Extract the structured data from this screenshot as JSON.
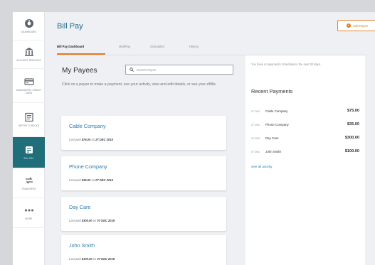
{
  "sidebar": {
    "items": [
      {
        "label": "DASHBOARD",
        "icon": "dashboard-icon",
        "active": false
      },
      {
        "label": "ACCOUNT SERVICES",
        "icon": "bank-icon",
        "active": false
      },
      {
        "label": "MANAGE/PAY CREDIT CARD",
        "icon": "credit-card-icon",
        "active": false
      },
      {
        "label": "DEPOSIT CHECKS",
        "icon": "check-deposit-icon",
        "active": false
      },
      {
        "label": "BILL PAY",
        "icon": "bill-pay-icon",
        "active": true
      },
      {
        "label": "TRANSFERS",
        "icon": "transfer-icon",
        "active": false
      },
      {
        "label": "MORE",
        "icon": "more-icon",
        "active": false
      }
    ]
  },
  "header": {
    "title": "Bill Pay",
    "add_payee_label": "Add Payee",
    "calculator_icon": "calculator-icon"
  },
  "tabs": [
    {
      "label": "Bill Pay Dashboard",
      "active": true
    },
    {
      "label": "MultiPay",
      "active": false
    },
    {
      "label": "Scheduled",
      "active": false
    },
    {
      "label": "History",
      "active": false
    }
  ],
  "payees": {
    "title": "My Payees",
    "search_placeholder": "Search Payee",
    "intro": "Click on a payee to make a payment, see your activity, view and edit details, or see your eBills.",
    "items": [
      {
        "name": "Cable Company",
        "last_paid_prefix": "Last paid",
        "amount": "$75.00",
        "on": "on",
        "date": "27 DEC 2018"
      },
      {
        "name": "Phone Company",
        "last_paid_prefix": "Last paid",
        "amount": "$35.00",
        "on": "on",
        "date": "07 DEC 2018"
      },
      {
        "name": "Day Care",
        "last_paid_prefix": "Last paid",
        "amount": "$300.00",
        "on": "on",
        "date": "07 DEC 2018"
      },
      {
        "name": "John Smith",
        "last_paid_prefix": "Last paid",
        "amount": "$100.00",
        "on": "on",
        "date": "07 DEC 2018"
      }
    ]
  },
  "recent": {
    "no_scheduled": "You have no payments scheduled in the next 30 days.",
    "title": "Recent Payments",
    "items": [
      {
        "date": "27 DEC",
        "payee": "Cable Company",
        "amount": "$75.00"
      },
      {
        "date": "27 DEC",
        "payee": "Phone Company",
        "amount": "$35.00"
      },
      {
        "date": "10 DEC",
        "payee": "Day Care",
        "amount": "$300.00"
      },
      {
        "date": "07 DEC",
        "payee": "John Smith",
        "amount": "$100.00"
      }
    ],
    "see_all": "See all activity"
  },
  "colors": {
    "brand_teal": "#1f6e7a",
    "accent_orange": "#e07a22",
    "link_blue": "#2a7cb0"
  }
}
